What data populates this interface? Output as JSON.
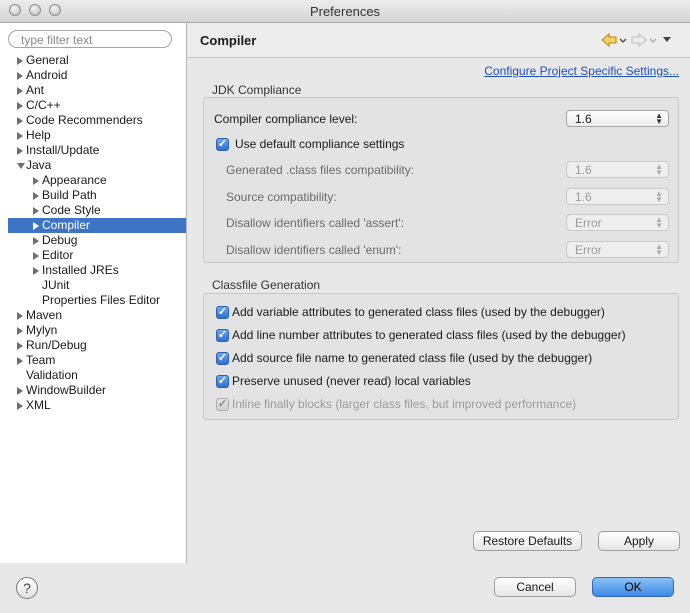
{
  "window": {
    "title": "Preferences"
  },
  "filter": {
    "placeholder": "type filter text"
  },
  "tree": [
    {
      "label": "General",
      "arrow": "right",
      "level": 0
    },
    {
      "label": "Android",
      "arrow": "right",
      "level": 0
    },
    {
      "label": "Ant",
      "arrow": "right",
      "level": 0
    },
    {
      "label": "C/C++",
      "arrow": "right",
      "level": 0
    },
    {
      "label": "Code Recommenders",
      "arrow": "right",
      "level": 0
    },
    {
      "label": "Help",
      "arrow": "right",
      "level": 0
    },
    {
      "label": "Install/Update",
      "arrow": "right",
      "level": 0
    },
    {
      "label": "Java",
      "arrow": "down",
      "level": 0
    },
    {
      "label": "Appearance",
      "arrow": "right",
      "level": 1
    },
    {
      "label": "Build Path",
      "arrow": "right",
      "level": 1
    },
    {
      "label": "Code Style",
      "arrow": "right",
      "level": 1
    },
    {
      "label": "Compiler",
      "arrow": "right",
      "level": 1,
      "selected": true
    },
    {
      "label": "Debug",
      "arrow": "right",
      "level": 1
    },
    {
      "label": "Editor",
      "arrow": "right",
      "level": 1
    },
    {
      "label": "Installed JREs",
      "arrow": "right",
      "level": 1
    },
    {
      "label": "JUnit",
      "arrow": "none",
      "level": 1
    },
    {
      "label": "Properties Files Editor",
      "arrow": "none",
      "level": 1
    },
    {
      "label": "Maven",
      "arrow": "right",
      "level": 0
    },
    {
      "label": "Mylyn",
      "arrow": "right",
      "level": 0
    },
    {
      "label": "Run/Debug",
      "arrow": "right",
      "level": 0
    },
    {
      "label": "Team",
      "arrow": "right",
      "level": 0
    },
    {
      "label": "Validation",
      "arrow": "none",
      "level": 0
    },
    {
      "label": "WindowBuilder",
      "arrow": "right",
      "level": 0
    },
    {
      "label": "XML",
      "arrow": "right",
      "level": 0
    }
  ],
  "page": {
    "title": "Compiler",
    "configure_link": "Configure Project Specific Settings...",
    "icons": [
      "back-arrow-icon",
      "forward-arrow-icon",
      "view-menu-icon"
    ]
  },
  "jdk": {
    "title": "JDK Compliance",
    "compliance_label": "Compiler compliance level:",
    "compliance_value": "1.6",
    "use_default_label": "Use default compliance settings",
    "use_default_checked": true,
    "generated_label": "Generated .class files compatibility:",
    "generated_value": "1.6",
    "source_label": "Source compatibility:",
    "source_value": "1.6",
    "assert_label": "Disallow identifiers called 'assert':",
    "assert_value": "Error",
    "enum_label": "Disallow identifiers called 'enum':",
    "enum_value": "Error"
  },
  "classfile": {
    "title": "Classfile Generation",
    "options": [
      {
        "label": "Add variable attributes to generated class files (used by the debugger)",
        "checked": true,
        "enabled": true
      },
      {
        "label": "Add line number attributes to generated class files (used by the debugger)",
        "checked": true,
        "enabled": true
      },
      {
        "label": "Add source file name to generated class file (used by the debugger)",
        "checked": true,
        "enabled": true
      },
      {
        "label": "Preserve unused (never read) local variables",
        "checked": true,
        "enabled": true
      },
      {
        "label": "Inline finally blocks (larger class files, but improved performance)",
        "checked": true,
        "enabled": false
      }
    ]
  },
  "buttons": {
    "restore": "Restore Defaults",
    "apply": "Apply",
    "cancel": "Cancel",
    "ok": "OK",
    "help": "?"
  },
  "colors": {
    "selection": "#3d75c4",
    "link": "#1f4fb8",
    "primary_button": "#3d8ae8"
  }
}
